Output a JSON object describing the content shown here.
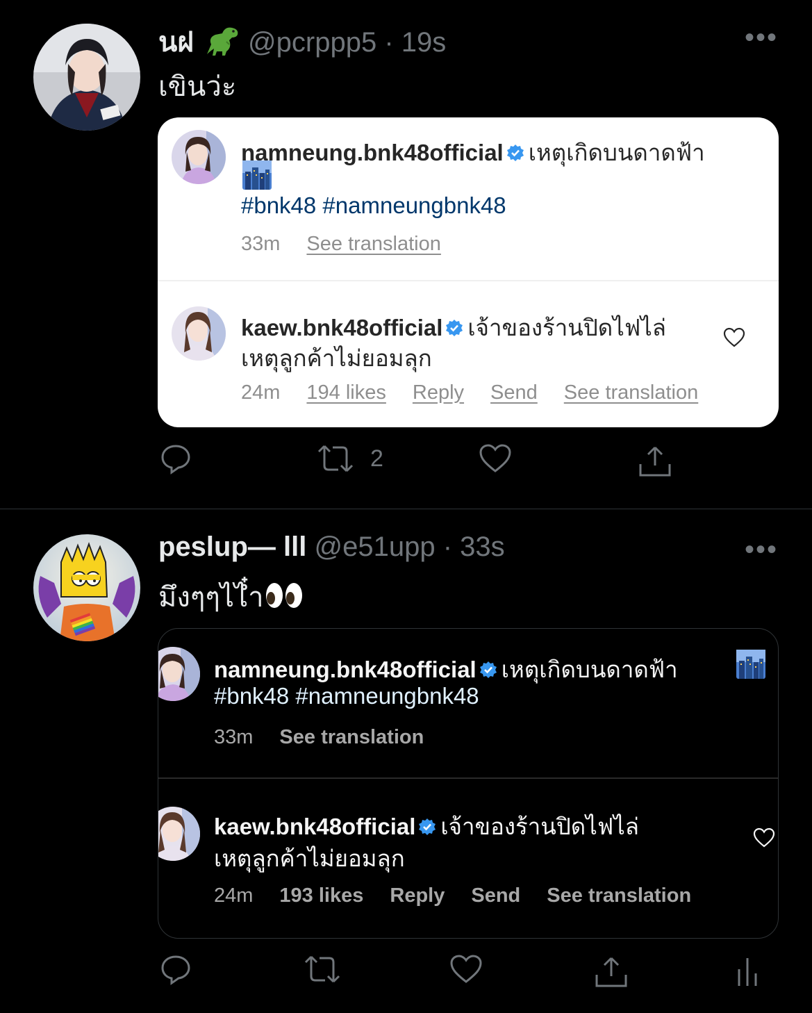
{
  "tweets": [
    {
      "display_name": "นฝ",
      "name_emoji": "t-rex-icon",
      "handle": "@pcrppp5",
      "separator": "·",
      "time": "19s",
      "text": "เขินว่ะ",
      "more": "•••",
      "card": {
        "theme": "light",
        "post": {
          "username": "namneung.bnk48official",
          "caption": "เหตุเกิดบนดาดฟ้า",
          "emoji": "cityscape-icon",
          "hashtags": "#bnk48 #namneungbnk48",
          "time": "33m",
          "see_translation": "See translation"
        },
        "comment": {
          "username": "kaew.bnk48official",
          "text_line1": "เจ้าของร้านปิดไฟไล่",
          "text_line2": "เหตุลูกค้าไม่ยอมลุก",
          "time": "24m",
          "likes": "194 likes",
          "reply": "Reply",
          "send": "Send",
          "see_translation": "See translation"
        }
      },
      "actions": {
        "retweets": "2"
      }
    },
    {
      "display_name": "peslup— lll",
      "handle": "@e51upp",
      "separator": "·",
      "time": "33s",
      "text": "มึงๆๆไไ๋ำ",
      "text_emoji": "eyes-icon",
      "more": "•••",
      "card": {
        "theme": "dark",
        "post": {
          "username": "namneung.bnk48official",
          "caption": "เหตุเกิดบนดาดฟ้า",
          "emoji": "cityscape-icon",
          "hashtags": "#bnk48 #namneungbnk48",
          "time": "33m",
          "see_translation": "See translation"
        },
        "comment": {
          "username": "kaew.bnk48official",
          "text_line1": "เจ้าของร้านปิดไฟไล่",
          "text_line2": "เหตุลูกค้าไม่ยอมลุก",
          "time": "24m",
          "likes": "193 likes",
          "reply": "Reply",
          "send": "Send",
          "see_translation": "See translation"
        }
      },
      "actions": {
        "retweets": ""
      }
    }
  ],
  "colors": {
    "background": "#000000",
    "secondary_text": "#71767b",
    "verified_blue": "#3897f0",
    "hashtag_dark_blue": "#00376b"
  }
}
